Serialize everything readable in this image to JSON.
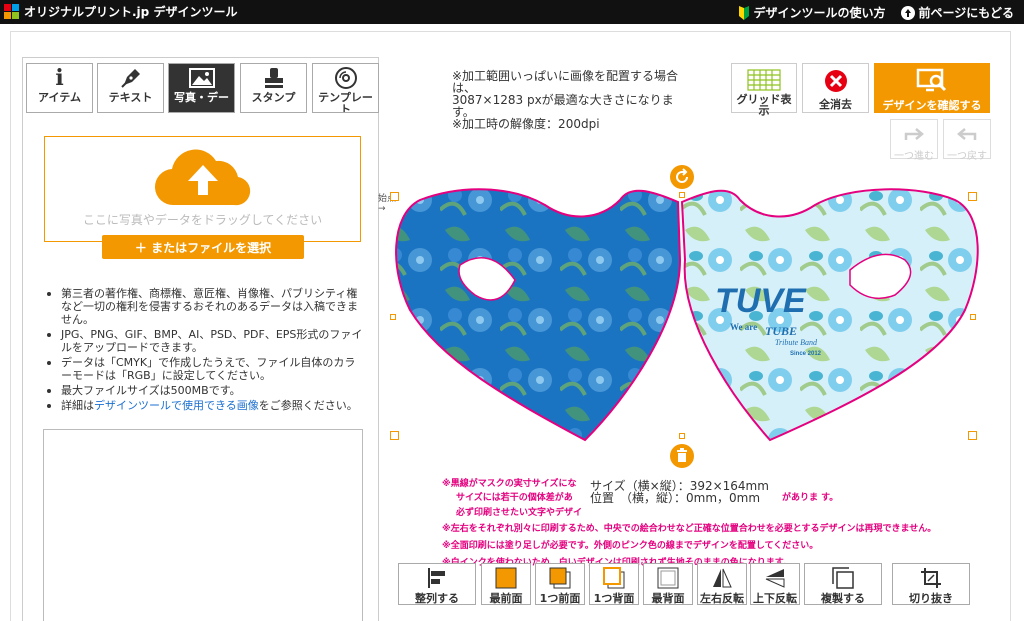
{
  "header": {
    "logo_text": "オリジナルプリント.jp デザインツール",
    "howto_link": "デザインツールの使い方",
    "back_link": "前ページにもどる"
  },
  "tabs": [
    {
      "label": "アイテム",
      "icon": "info-icon"
    },
    {
      "label": "テキスト",
      "icon": "pen-icon"
    },
    {
      "label": "写真・デー",
      "icon": "image-icon"
    },
    {
      "label": "スタンプ",
      "icon": "stamp-icon"
    },
    {
      "label": "テンプレート",
      "icon": "template-icon"
    }
  ],
  "upload": {
    "drop_text": "ここに写真やデータをドラッグしてください",
    "file_button": "＋ またはファイルを選択"
  },
  "notes": [
    "第三者の著作権、商標権、意匠権、肖像権、パブリシティ権など一切の権利を侵害するおそれのあるデータは入稿できません。",
    "JPG、PNG、GIF、BMP、AI、PSD、PDF、EPS形式のファイルをアップロードできます。",
    "データは「CMYK」で作成したうえで、ファイル自体のカラーモードは「RGB」に設定してください。",
    "最大ファイルサイズは500MBです。"
  ],
  "notes_last": {
    "prefix": "詳細は",
    "link": "デザインツールで使用できる画像",
    "suffix": "をご参照ください。"
  },
  "print_info": {
    "line1": "※加工範囲いっぱいに画像を配置する場合は、",
    "line2": "3087×1283 pxが最適な大きさになります。",
    "line3": "※加工時の解像度：200dpi"
  },
  "toolbar": {
    "grid": "グリッド表示",
    "clear": "全消去",
    "confirm": "デザインを確認する",
    "redo": "一つ進む",
    "undo": "一つ戻す"
  },
  "canvas": {
    "start_label": "始点",
    "logo_text": "TUVE",
    "logo_sub1": "We are",
    "logo_sub2": "TUBE",
    "logo_sub3": "Tribute Band",
    "logo_sub4": "Since 2012"
  },
  "size_info": {
    "size": "サイズ（横×縦）：392×164mm",
    "position": "位置　（横，縦）：0mm，0mm"
  },
  "warnings": [
    "※黒線がマスクの実寸サイズにな",
    "サイズには若干の個体差があ",
    "がありま す。",
    "必ず印刷させたい文字やデザイ",
    "※左右をそれぞれ別々に印刷するため、中央での絵合わせなど正確な位置合わせを必要とするデザインは再現できません。",
    "※全面印刷には塗り足しが必要です。外側のピンク色の線までデザインを配置してください。",
    "※白インクを使わないため、白いデザインは印刷されず生地そのままの色になります。"
  ],
  "bottom_tools": [
    {
      "label": "整列する",
      "icon": "align-icon"
    },
    {
      "label": "最前面",
      "icon": "bring-front-icon"
    },
    {
      "label": "1つ前面",
      "icon": "bring-forward-icon"
    },
    {
      "label": "1つ背面",
      "icon": "send-backward-icon"
    },
    {
      "label": "最背面",
      "icon": "send-back-icon"
    },
    {
      "label": "左右反転",
      "icon": "flip-horizontal-icon"
    },
    {
      "label": "上下反転",
      "icon": "flip-vertical-icon"
    },
    {
      "label": "複製する",
      "icon": "duplicate-icon"
    },
    {
      "label": "切り抜き",
      "icon": "crop-icon"
    }
  ],
  "colors": {
    "accent": "#f39800",
    "pink": "#e4007f",
    "mask_left": "#1b74c2",
    "mask_right": "#bfe7f5"
  }
}
